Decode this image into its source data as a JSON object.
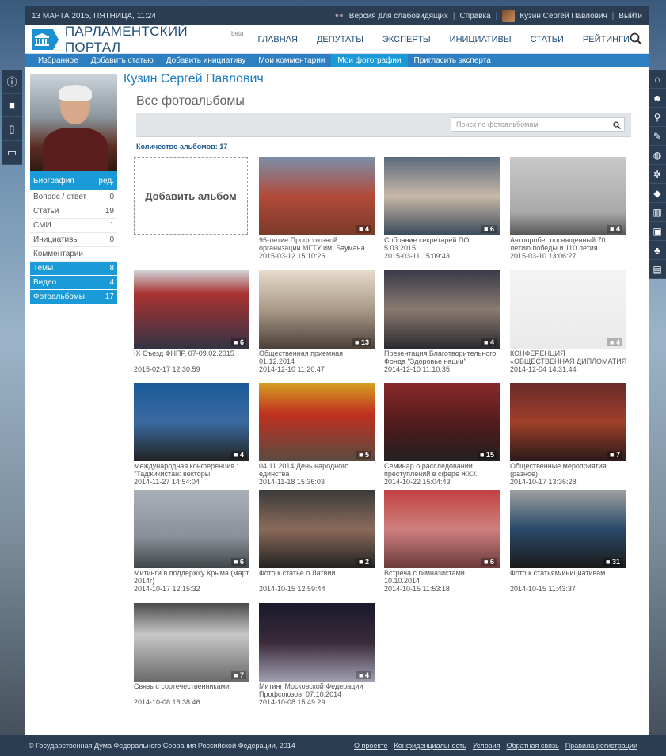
{
  "topbar": {
    "datetime": "13 МАРТА 2015, ПЯТНИЦА, 11:24",
    "accessibility": "Версия для слабовидящих",
    "help": "Справка",
    "user": "Кузин Сергей Павлович",
    "logout": "Выйти"
  },
  "header": {
    "title": "ПАРЛАМЕНТСКИЙ ПОРТАЛ",
    "beta": "beta",
    "nav": [
      "ГЛАВНАЯ",
      "ДЕПУТАТЫ",
      "ЭКСПЕРТЫ",
      "ИНИЦИАТИВЫ",
      "СТАТЬИ",
      "РЕЙТИНГИ"
    ]
  },
  "subnav": [
    "Избранное",
    "Добавить статью",
    "Добавить инициативу",
    "Мои комментарии",
    "Мои фотографии",
    "Пригласить эксперта"
  ],
  "profile": {
    "name": "Кузин Сергей Павлович",
    "bio_label": "Биография",
    "edit_label": "ред.",
    "menu": [
      {
        "label": "Вопрос / ответ",
        "count": "0",
        "active": false
      },
      {
        "label": "Статьи",
        "count": "19",
        "active": false
      },
      {
        "label": "СМИ",
        "count": "1",
        "active": false
      },
      {
        "label": "Инициативы",
        "count": "0",
        "active": false
      },
      {
        "label": "Комментарии",
        "count": "",
        "active": false
      },
      {
        "label": "Темы",
        "count": "8",
        "active": true
      },
      {
        "label": "Видео",
        "count": "4",
        "active": true
      },
      {
        "label": "Фотоальбомы",
        "count": "17",
        "active": true
      }
    ]
  },
  "main": {
    "heading": "Все фотоальбомы",
    "search_placeholder": "Поиск по фотоальбомам",
    "album_count_label": "Количество альбомов: 17",
    "add_album": "Добавить альбом"
  },
  "albums": [
    {
      "title": "95-летие Профсоюзной организации МГТУ им. Баумана",
      "date": "2015-03-12 15:10:26",
      "count": "4"
    },
    {
      "title": "Собрание секретарей ПО 5.03.2015",
      "date": "2015-03-11 15:09:43",
      "count": "6"
    },
    {
      "title": "Автопробег посвященный 70 летию победы и 110 летия",
      "date": "2015-03-10 13:06:27",
      "count": "4"
    },
    {
      "title": "IX Съезд ФНПР, 07-09.02.2015",
      "date": "2015-02-17 12:30:59",
      "count": "6"
    },
    {
      "title": "Общественная приемная 01.12.2014",
      "date": "2014-12-10 11:20:47",
      "count": "13"
    },
    {
      "title": "Презентация Благотворительного Фонда \"Здоровье нации\"",
      "date": "2014-12-10 11:10:35",
      "count": "4"
    },
    {
      "title": "КОНФЕРЕНЦИЯ «ОБЩЕСТВЕННАЯ ДИПЛОМАТИЯ ЗА ЕВРАЗИЙСКУЮ",
      "date": "2014-12-04 14:31:44",
      "count": "4"
    },
    {
      "title": "Международная конференция : \"Таджикистан: векторы",
      "date": "2014-11-27 14:54:04",
      "count": "4"
    },
    {
      "title": "04.11.2014 День народного единства",
      "date": "2014-11-18 15:36:03",
      "count": "5"
    },
    {
      "title": "Семинар о расследовании преступлений в сфере ЖКХ",
      "date": "2014-10-22 15:04:43",
      "count": "15"
    },
    {
      "title": "Общественные мероприятия (разное)",
      "date": "2014-10-17 13:36:28",
      "count": "7"
    },
    {
      "title": "Митинги в поддержку Крыма (март 2014г)",
      "date": "2014-10-17 12:15:32",
      "count": "6"
    },
    {
      "title": "Фото к статье о Латвии",
      "date": "2014-10-15 12:59:44",
      "count": "2"
    },
    {
      "title": "Встреча с гимназистами 10.10.2014",
      "date": "2014-10-15 11:53:18",
      "count": "6"
    },
    {
      "title": "Фото к статьям/инициативам",
      "date": "2014-10-15 11:43:37",
      "count": "31"
    },
    {
      "title": "Связь с соотечественниками",
      "date": "2014-10-08 16:38:46",
      "count": "7"
    },
    {
      "title": "Митинг Московской Федерации Профсоюзов, 07.10.2014",
      "date": "2014-10-08 15:49:29",
      "count": "4"
    }
  ],
  "colors": {
    "accent": "#1a9ad6",
    "dark": "#2b3d52",
    "link": "#1a7bc0"
  },
  "footer": {
    "copyright": "© Государственная Дума Федерального Собрания Российской Федерации, 2014",
    "links": [
      "О проекте",
      "Конфиденциальность",
      "Условия",
      "Обратная связь",
      "Правила регистрации"
    ]
  }
}
